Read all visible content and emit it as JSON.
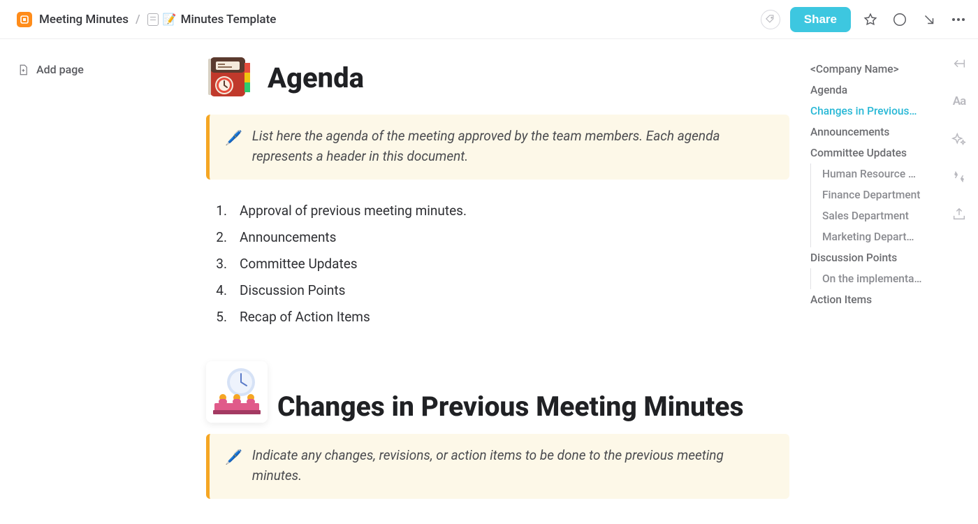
{
  "breadcrumb": {
    "workspace": "Meeting Minutes",
    "page_icon": "📝",
    "page": "Minutes Template"
  },
  "topbar": {
    "share": "Share"
  },
  "left": {
    "add_page": "Add page"
  },
  "doc": {
    "agenda": {
      "title": "Agenda",
      "callout": "List here the agenda of the meeting approved by the team members. Each agenda represents a header in this document.",
      "items": [
        "Approval of previous meeting minutes.",
        "Announcements",
        "Committee Updates",
        "Discussion Points",
        "Recap of Action Items"
      ]
    },
    "changes": {
      "title": "Changes in Previous Meeting Minutes",
      "callout": "Indicate any changes, revisions, or action items to be done to the previous meeting minutes."
    }
  },
  "outline": {
    "items": [
      "<Company Name>",
      "Agenda",
      "Changes in Previous…",
      "Announcements",
      "Committee Updates",
      "Human Resource …",
      "Finance Department",
      "Sales Department",
      "Marketing Depart…",
      "Discussion Points",
      "On the implementa…",
      "Action Items"
    ],
    "active_index": 2,
    "sub_indices": [
      5,
      6,
      7,
      8,
      10
    ]
  }
}
